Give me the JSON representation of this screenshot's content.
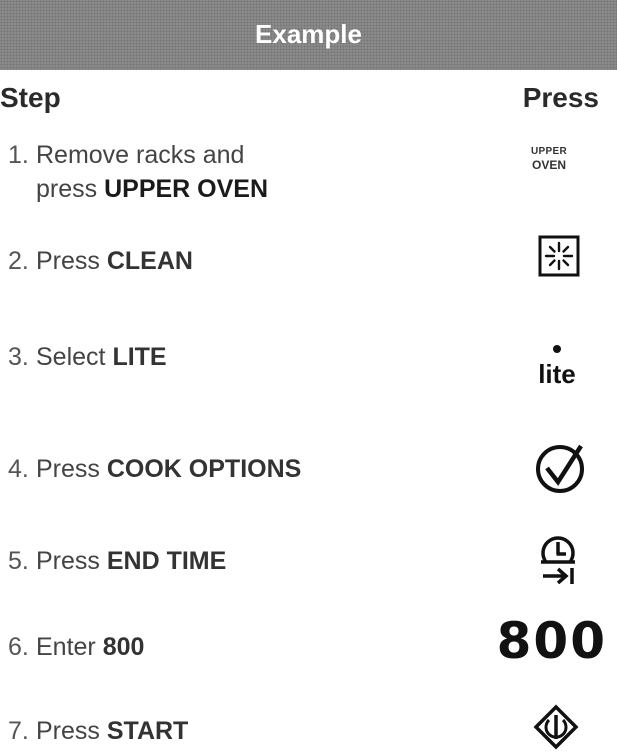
{
  "banner": {
    "title": "Example"
  },
  "headers": {
    "step": "Step",
    "press": "Press"
  },
  "steps": [
    {
      "num": "1.",
      "line1": "Remove racks and",
      "line2_pre": "press ",
      "line2_bold": "UPPER OVEN"
    },
    {
      "num": "2.",
      "pre": "Press ",
      "bold": "CLEAN"
    },
    {
      "num": "3.",
      "pre": "Select ",
      "bold": "LITE"
    },
    {
      "num": "4.",
      "pre": "Press ",
      "bold": "COOK OPTIONS"
    },
    {
      "num": "5.",
      "pre": "Press ",
      "bold": "END TIME"
    },
    {
      "num": "6.",
      "pre": "Enter ",
      "bold": "800"
    },
    {
      "num": "7.",
      "pre": "Press ",
      "bold": "START"
    }
  ],
  "icons": {
    "upper_oven_line1": "UPPER",
    "upper_oven_line2": "OVEN",
    "clean": "clean-icon",
    "lite_label": "lite",
    "cook_options": "checkmark-circle-icon",
    "end_time": "end-time-icon",
    "enter_value": "800",
    "start": "start-icon"
  }
}
